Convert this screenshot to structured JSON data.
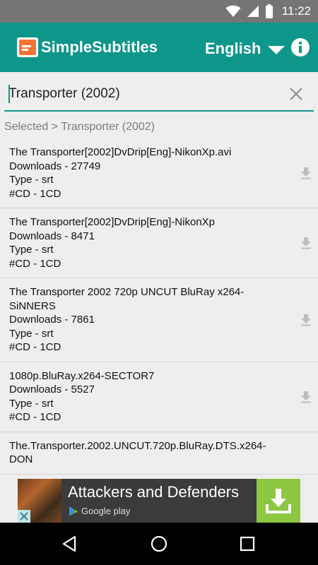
{
  "status_bar": {
    "time": "11:22",
    "icons": [
      "wifi-icon",
      "signal-icon",
      "battery-icon"
    ]
  },
  "app_bar": {
    "title": "SimpleSubtitles",
    "language": "English",
    "logo_icon": "subtitle-logo-icon",
    "info_icon": "info-icon"
  },
  "search": {
    "value": "Transporter (2002)",
    "clear_icon": "close-icon"
  },
  "breadcrumb": "Selected > Transporter (2002)",
  "results": [
    {
      "name": "The Transporter[2002]DvDrip[Eng]-NikonXp.avi",
      "downloads": "Downloads - 27749",
      "type": "Type - srt",
      "cd": "#CD - 1CD"
    },
    {
      "name": "The Transporter[2002]DvDrip[Eng]-NikonXp",
      "downloads": "Downloads - 8471",
      "type": "Type - srt",
      "cd": "#CD - 1CD"
    },
    {
      "name": "The Transporter 2002 720p UNCUT BluRay x264-SiNNERS",
      "downloads": "Downloads - 7861",
      "type": "Type - srt",
      "cd": "#CD - 1CD"
    },
    {
      "name": "1080p.BluRay.x264-SECTOR7",
      "downloads": "Downloads - 5527",
      "type": "Type - srt",
      "cd": "#CD - 1CD"
    },
    {
      "name": "The.Transporter.2002.UNCUT.720p.BluRay.DTS.x264-DON",
      "downloads": "",
      "type": "",
      "cd": ""
    }
  ],
  "ad": {
    "title": "Attackers and Defenders",
    "store": "Google play",
    "cta_icon": "download-icon"
  },
  "colors": {
    "primary": "#0e968a",
    "status_bar": "#757575",
    "ad_cta": "#8dc63f"
  }
}
